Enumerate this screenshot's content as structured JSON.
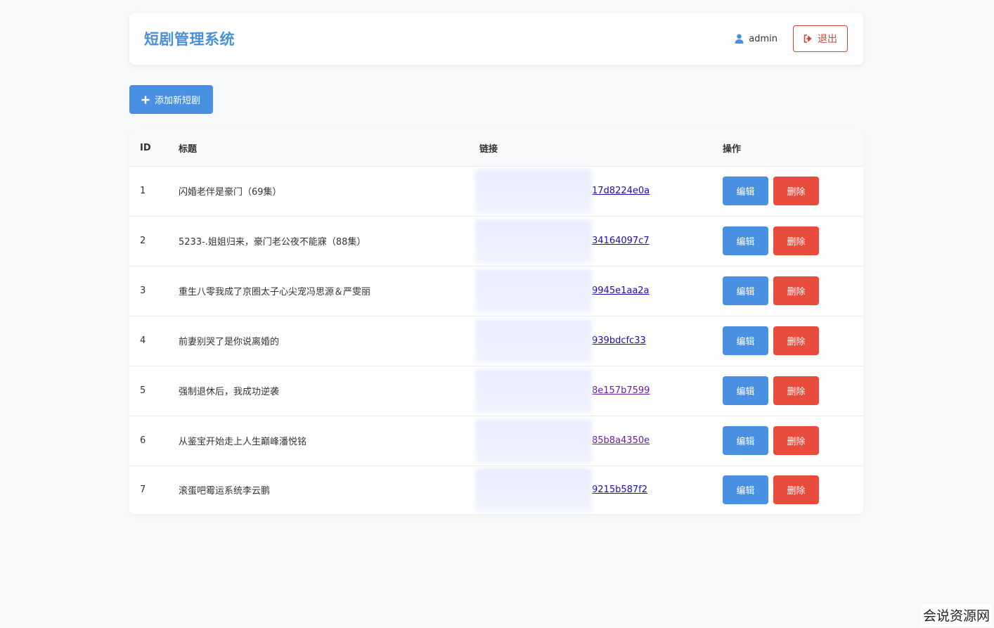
{
  "header": {
    "title": "短剧管理系统",
    "username": "admin",
    "logout_label": "退出"
  },
  "toolbar": {
    "add_label": "添加新短剧"
  },
  "table": {
    "columns": [
      "ID",
      "标题",
      "链接",
      "操作"
    ],
    "edit_label": "编辑",
    "delete_label": "删除",
    "rows": [
      {
        "id": "1",
        "title": "闪婚老伴是豪门（69集）",
        "link_tail": "17d8224e0a"
      },
      {
        "id": "2",
        "title": "5233-.姐姐归来，豪门老公夜不能寐（88集）",
        "link_tail": "34164097c7"
      },
      {
        "id": "3",
        "title": "重生八零我成了京圈太子心尖宠冯思源＆严雯丽",
        "link_tail": "9945e1aa2a"
      },
      {
        "id": "4",
        "title": "前妻别哭了是你说离婚的",
        "link_tail": "939bdcfc33"
      },
      {
        "id": "5",
        "title": "强制退休后，我成功逆袭",
        "link_tail": "8e157b7599"
      },
      {
        "id": "6",
        "title": "从鉴宝开始走上人生巅峰潘悦铭",
        "link_tail": "85b8a4350e"
      },
      {
        "id": "7",
        "title": "滚蛋吧霉运系统李云鹏",
        "link_tail": "9215b587f2"
      }
    ]
  },
  "watermark": "会说资源网",
  "colors": {
    "brand": "#4a90d9",
    "primary": "#4a90e2",
    "danger": "#e74c3c",
    "logout": "#c9473b",
    "link": "#1a0dab",
    "link_visited": "#681da8"
  }
}
